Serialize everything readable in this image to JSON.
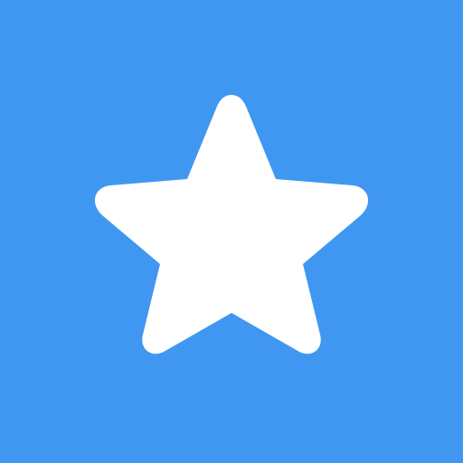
{
  "icon": {
    "name": "star-icon",
    "background_color": "#4097F2",
    "foreground_color": "#FFFFFF"
  }
}
